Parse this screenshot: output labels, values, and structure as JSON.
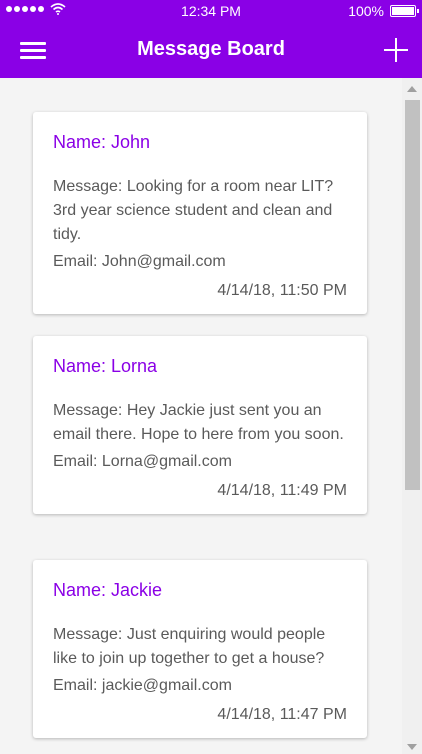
{
  "status_bar": {
    "time": "12:34 PM",
    "battery_percent": "100%",
    "signal_bars": 5,
    "icons": [
      "signal-dots-icon",
      "wifi-icon",
      "battery-icon"
    ]
  },
  "header": {
    "title": "Message Board",
    "left_icon": "menu-icon",
    "right_icon": "plus-icon"
  },
  "colors": {
    "brand": "#8a00e6",
    "text": "#5a5a5a"
  },
  "messages": [
    {
      "name": "Name: John",
      "message": "Message: Looking for a room near LIT? 3rd year science student and clean and tidy.",
      "email": "Email: John@gmail.com",
      "time": "4/14/18, 11:50 PM"
    },
    {
      "name": "Name: Lorna",
      "message": "Message: Hey Jackie just sent you an email there. Hope to here from you soon.",
      "email": "Email: Lorna@gmail.com",
      "time": "4/14/18, 11:49 PM"
    },
    {
      "name": "Name: Jackie",
      "message": "Message: Just enquiring would people like to join up together to get a house?",
      "email": "Email: jackie@gmail.com",
      "time": "4/14/18, 11:47 PM"
    }
  ]
}
